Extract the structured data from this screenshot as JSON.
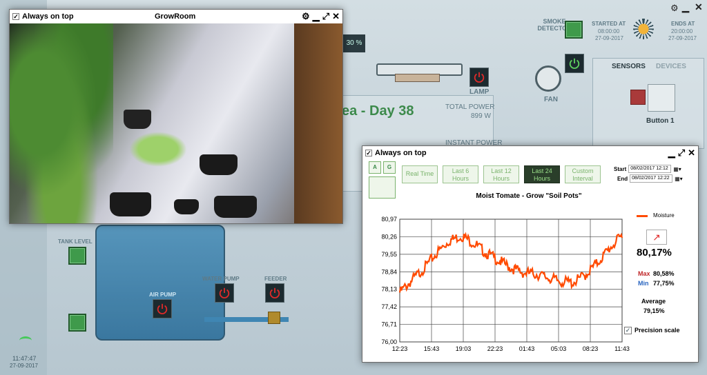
{
  "background": {
    "area_title": "ea - Day 38",
    "total_power_label": "TOTAL POWER",
    "total_power_value": "899 W",
    "instant_power_label": "INSTANT POWER",
    "percent_badge": "30 %",
    "lamp_label": "LAMP",
    "fan_label": "FAN",
    "smoke_label": "SMOKE\nDETECTOR",
    "started_label": "STARTED AT",
    "started_time": "08:00:00",
    "started_date": "27-09-2017",
    "ends_label": "ENDS AT",
    "ends_time": "20:00:00",
    "ends_date": "27-09-2017",
    "tab_sensors": "SENSORS",
    "tab_devices": "DEVICES",
    "button1_label": "Button 1",
    "tank_level_label": "TANK LEVEL",
    "air_pump_label": "AIR PUMP",
    "water_pump_label": "WATER PUMP",
    "feeder_label": "FEEDER",
    "clock_time": "11:47:47",
    "clock_date": "27-09-2017"
  },
  "camera_window": {
    "always_on_top": "Always on top",
    "title": "GrowRoom"
  },
  "chart_window": {
    "always_on_top": "Always on top",
    "range_buttons": [
      "Real Time",
      "Last 6\nHours",
      "Last 12\nHours",
      "Last 24\nHours",
      "Custom\nInterval"
    ],
    "active_range": 3,
    "start_label": "Start",
    "start_value": "08/02/2017 12:12",
    "end_label": "End",
    "end_value": "08/02/2017 12:22",
    "current_value": "80,17%",
    "max_label": "Max",
    "max_value": "80,58%",
    "min_label": "Min",
    "min_value": "77,75%",
    "average_label": "Average",
    "average_value": "79,15%",
    "precision_label": "Precision scale"
  },
  "chart_data": {
    "type": "line",
    "title": "Moist Tomate - Grow \"Soil Pots\"",
    "series": [
      {
        "name": "Moisture",
        "color": "#ff4a00",
        "x": [
          "12:23",
          "13:50",
          "15:43",
          "17:20",
          "18:30",
          "19:03",
          "20:00",
          "22:23",
          "00:00",
          "01:43",
          "03:03",
          "04:30",
          "05:03",
          "06:30",
          "07:30",
          "08:23",
          "09:30",
          "10:30",
          "11:43"
        ],
        "values": [
          78.0,
          78.5,
          79.0,
          79.6,
          80.1,
          80.3,
          80.0,
          79.6,
          79.3,
          79.0,
          78.8,
          78.75,
          78.6,
          78.45,
          78.4,
          78.7,
          79.2,
          79.8,
          80.3
        ]
      }
    ],
    "x_ticks": [
      "12:23",
      "15:43",
      "19:03",
      "22:23",
      "01:43",
      "05:03",
      "08:23",
      "11:43"
    ],
    "y_ticks": [
      "80,97",
      "80,26",
      "79,55",
      "78,84",
      "78,13",
      "77,42",
      "76,71",
      "76,00"
    ],
    "ylim": [
      76.0,
      80.97
    ],
    "grid": true,
    "legend": "top-right"
  },
  "colors": {
    "accent_green": "#3f9a4b",
    "series_orange": "#ff4a00",
    "active_button": "#2a3e2a"
  }
}
